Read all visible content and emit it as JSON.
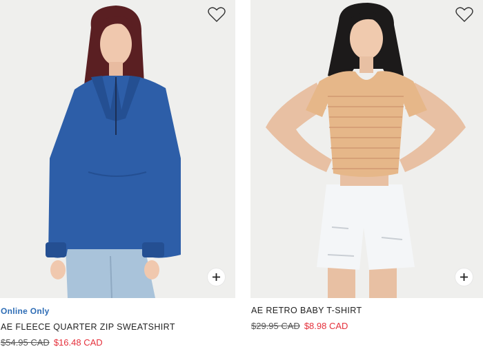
{
  "colors": {
    "photo_bg": "#eeeeec",
    "online_only": "#2d6cb5",
    "sale_price": "#e5303b",
    "original_price": "#555555"
  },
  "products": [
    {
      "badge": "Online Only",
      "name": "AE FLEECE QUARTER ZIP SWEATSHIRT",
      "original_price": "$54.95 CAD",
      "sale_price": "$16.48 CAD",
      "favorite_icon": "heart-outline-icon",
      "add_icon": "plus-icon"
    },
    {
      "badge": "",
      "name": "AE RETRO BABY T-SHIRT",
      "original_price": "$29.95 CAD",
      "sale_price": "$8.98 CAD",
      "favorite_icon": "heart-outline-icon",
      "add_icon": "plus-icon"
    }
  ]
}
